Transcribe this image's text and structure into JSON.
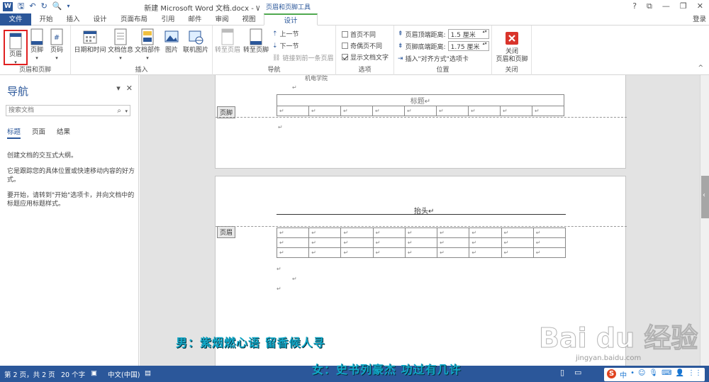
{
  "title_bar": {
    "window_title": "新建 Microsoft Word 文档.docx - Word",
    "context_title": "页眉和页脚工具",
    "controls": [
      "?",
      "⧉",
      "—",
      "❐",
      "✕"
    ]
  },
  "tabs": {
    "file": "文件",
    "items": [
      "开始",
      "插入",
      "设计",
      "页面布局",
      "引用",
      "邮件",
      "审阅",
      "视图",
      "设计"
    ],
    "login": "登录"
  },
  "ribbon": {
    "header_footer_group": {
      "label": "页眉和页脚",
      "header": "页眉",
      "footer": "页脚",
      "page_number": "页码"
    },
    "insert_group": {
      "label": "插入",
      "datetime": "日期和时间",
      "docinfo": "文档信息",
      "quickparts": "文档部件",
      "picture": "图片",
      "online_picture": "联机图片"
    },
    "navigation_group": {
      "label": "导航",
      "goto_header": "转至页眉",
      "goto_footer": "转至页脚",
      "prev": "上一节",
      "next": "下一节",
      "link_prev": "链接到前一条页眉"
    },
    "options_group": {
      "label": "选项",
      "first_page": "首页不同",
      "odd_even": "奇偶页不同",
      "show_text": "显示文档文字"
    },
    "position_group": {
      "label": "位置",
      "header_dist_label": "页眉顶端距离:",
      "header_dist_value": "1.5 厘米",
      "footer_dist_label": "页脚底端距离:",
      "footer_dist_value": "1.75 厘米",
      "insert_align_tab": "插入\"对齐方式\"选项卡"
    },
    "close_group": {
      "label": "关闭",
      "close_line1": "关闭",
      "close_line2": "页眉和页脚"
    }
  },
  "nav_pane": {
    "title": "导航",
    "search_placeholder": "搜索文档",
    "tabs": [
      "标题",
      "页面",
      "结果"
    ],
    "text1": "创建文档的交互式大纲。",
    "text2": "它是跟踪您的具体位置或快速移动内容的好方式。",
    "text3": "要开始，请转到\"开始\"选项卡，并向文档中的标题应用标题样式。"
  },
  "document": {
    "page1_top_text": "机电学院",
    "page1_table_title": "标题",
    "footer_tag": "页脚",
    "page2_header_text": "抬头",
    "header_tag": "页眉",
    "para_mark": "↵"
  },
  "status_bar": {
    "page": "第 2 页，共 2 页",
    "words": "20 个字",
    "language": "中文(中国)"
  },
  "overlay": {
    "line1": "男：紫烟燃心语  留香候人寻",
    "line2": "女：史书列豪杰  功过有几许",
    "watermark": "Bai du 经验",
    "watermark_url": "jingyan.baidu.com",
    "tray_text": "中"
  },
  "colors": {
    "accent": "#2b579a",
    "context_green": "#4fa94f",
    "subtitle": "#11a8c8",
    "highlight_box": "#e02020"
  }
}
